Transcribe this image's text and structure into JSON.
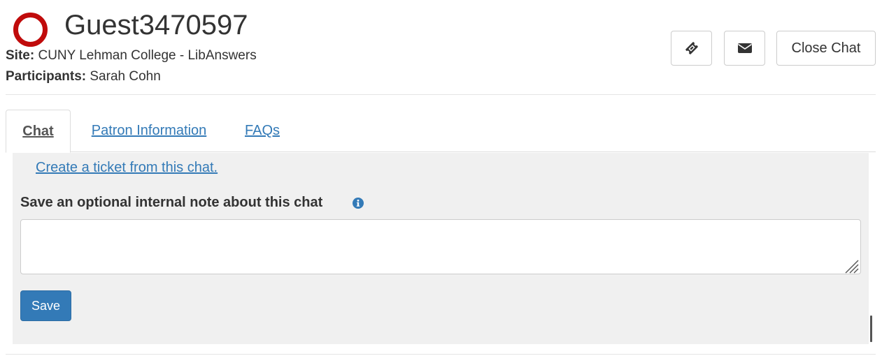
{
  "header": {
    "guest_name": "Guest3470597",
    "site_label": "Site:",
    "site_value": " CUNY Lehman College - LibAnswers",
    "participants_label": "Participants:",
    "participants_value": " Sarah Cohn",
    "status_color": "#c00b0b",
    "buttons": {
      "ticket_icon": "ticket-icon",
      "email_icon": "envelope-icon",
      "close_label": "Close Chat"
    }
  },
  "tabs": [
    {
      "label": "Chat",
      "active": true
    },
    {
      "label": "Patron Information",
      "active": false
    },
    {
      "label": "FAQs",
      "active": false
    }
  ],
  "panel": {
    "ticket_link": "Create a ticket from this chat.",
    "note_label": "Save an optional internal note about this chat",
    "note_value": "",
    "save_label": "Save"
  },
  "colors": {
    "link": "#337ab7",
    "primary_button": "#337ab7",
    "panel_bg": "#f0f0f0"
  }
}
